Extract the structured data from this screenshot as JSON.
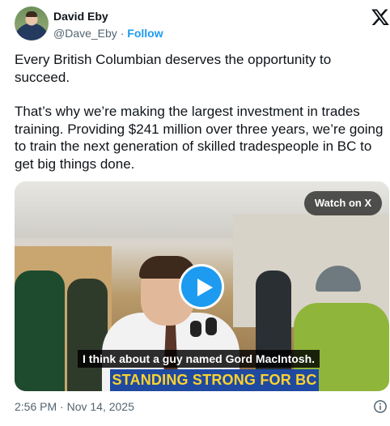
{
  "author": {
    "name": "David Eby",
    "handle": "@Dave_Eby",
    "separator": "·",
    "follow_label": "Follow"
  },
  "brand": {
    "logo_icon": "x-logo-icon"
  },
  "post": {
    "paragraph_1": "Every British Columbian deserves the opportunity to succeed.",
    "paragraph_2": "That’s why we’re making the largest investment in trades training. Providing $241 million over three years, we’re going to train the next generation of skilled tradespeople in BC to get big things done."
  },
  "video": {
    "watch_label": "Watch on X",
    "play_icon": "play-icon",
    "caption": "I think about a guy named Gord MacIntosh.",
    "banner": "STANDING STRONG FOR BC"
  },
  "footer": {
    "timestamp": "2:56 PM · Nov 14, 2025",
    "info_icon": "info-icon"
  },
  "colors": {
    "accent": "#1d9bf0",
    "text": "#0f1419",
    "muted": "#536471",
    "banner_bg": "#1f4aa0",
    "banner_text": "#ffd22e"
  }
}
